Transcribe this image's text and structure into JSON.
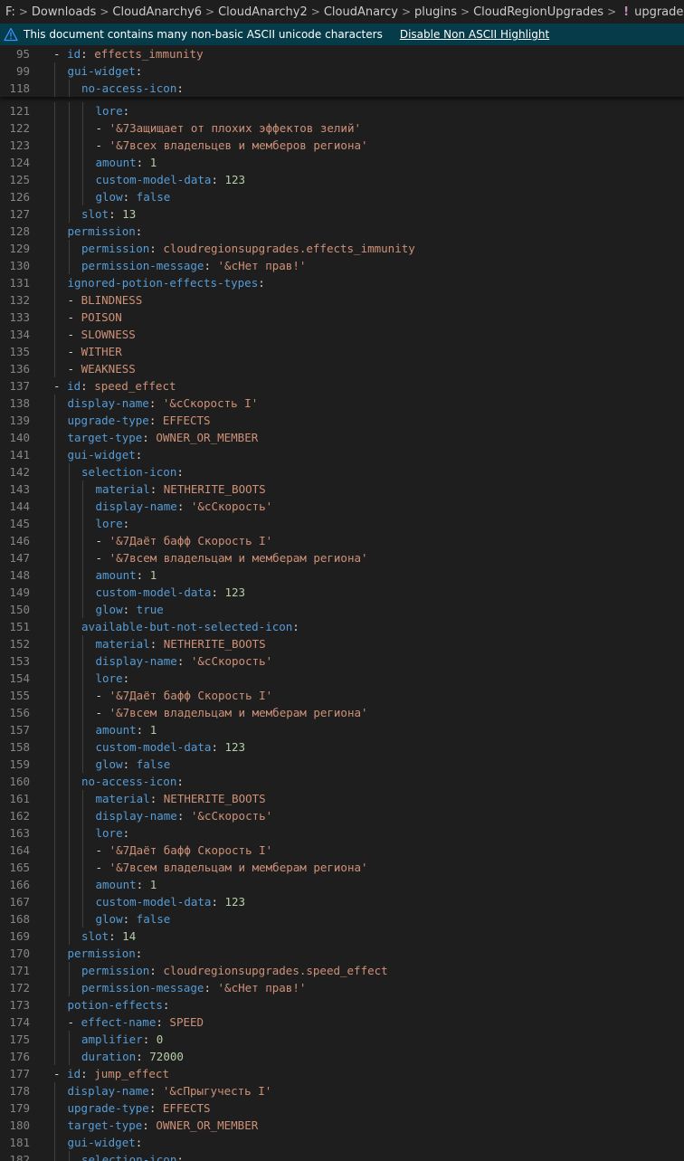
{
  "breadcrumb": {
    "items": [
      "F:",
      "Downloads",
      "CloudAnarchy6",
      "CloudAnarchy2",
      "CloudAnarcy",
      "plugins",
      "CloudRegionUpgrades"
    ],
    "file_icon": "!",
    "file": "upgrades.yml"
  },
  "banner": {
    "message": "This document contains many non-basic ASCII unicode characters",
    "action": "Disable Non ASCII Highlight"
  },
  "sticky_lines": [
    {
      "n": "95",
      "d": 0,
      "t": [
        [
          "p",
          "- "
        ],
        [
          "k",
          "id"
        ],
        [
          "p",
          ": "
        ],
        [
          "s",
          "effects_immunity"
        ]
      ]
    },
    {
      "n": "99",
      "d": 1,
      "t": [
        [
          "k",
          "gui-widget"
        ],
        [
          "p",
          ":"
        ]
      ]
    },
    {
      "n": "118",
      "d": 2,
      "t": [
        [
          "k",
          "no-access-icon"
        ],
        [
          "p",
          ":"
        ]
      ]
    }
  ],
  "lines": [
    {
      "n": "121",
      "d": 3,
      "t": [
        [
          "k",
          "lore"
        ],
        [
          "p",
          ":"
        ]
      ]
    },
    {
      "n": "122",
      "d": 3,
      "t": [
        [
          "p",
          "- "
        ],
        [
          "s",
          "'&7Защищает от плохих эффектов зелий'"
        ]
      ]
    },
    {
      "n": "123",
      "d": 3,
      "t": [
        [
          "p",
          "- "
        ],
        [
          "s",
          "'&7всех владельцев и мемберов региона'"
        ]
      ]
    },
    {
      "n": "124",
      "d": 3,
      "t": [
        [
          "k",
          "amount"
        ],
        [
          "p",
          ": "
        ],
        [
          "n",
          "1"
        ]
      ]
    },
    {
      "n": "125",
      "d": 3,
      "t": [
        [
          "k",
          "custom-model-data"
        ],
        [
          "p",
          ": "
        ],
        [
          "n",
          "123"
        ]
      ]
    },
    {
      "n": "126",
      "d": 3,
      "t": [
        [
          "k",
          "glow"
        ],
        [
          "p",
          ": "
        ],
        [
          "b",
          "false"
        ]
      ]
    },
    {
      "n": "127",
      "d": 2,
      "t": [
        [
          "k",
          "slot"
        ],
        [
          "p",
          ": "
        ],
        [
          "n",
          "13"
        ]
      ]
    },
    {
      "n": "128",
      "d": 1,
      "t": [
        [
          "k",
          "permission"
        ],
        [
          "p",
          ":"
        ]
      ]
    },
    {
      "n": "129",
      "d": 2,
      "t": [
        [
          "k",
          "permission"
        ],
        [
          "p",
          ": "
        ],
        [
          "s",
          "cloudregionsupgrades.effects_immunity"
        ]
      ]
    },
    {
      "n": "130",
      "d": 2,
      "t": [
        [
          "k",
          "permission-message"
        ],
        [
          "p",
          ": "
        ],
        [
          "s",
          "'&сНет прав!'"
        ]
      ]
    },
    {
      "n": "131",
      "d": 1,
      "t": [
        [
          "k",
          "ignored-potion-effects-types"
        ],
        [
          "p",
          ":"
        ]
      ]
    },
    {
      "n": "132",
      "d": 1,
      "t": [
        [
          "p",
          "- "
        ],
        [
          "s",
          "BLINDNESS"
        ]
      ]
    },
    {
      "n": "133",
      "d": 1,
      "t": [
        [
          "p",
          "- "
        ],
        [
          "s",
          "POISON"
        ]
      ]
    },
    {
      "n": "134",
      "d": 1,
      "t": [
        [
          "p",
          "- "
        ],
        [
          "s",
          "SLOWNESS"
        ]
      ]
    },
    {
      "n": "135",
      "d": 1,
      "t": [
        [
          "p",
          "- "
        ],
        [
          "s",
          "WITHER"
        ]
      ]
    },
    {
      "n": "136",
      "d": 1,
      "t": [
        [
          "p",
          "- "
        ],
        [
          "s",
          "WEAKNESS"
        ]
      ]
    },
    {
      "n": "137",
      "d": 0,
      "t": [
        [
          "p",
          "- "
        ],
        [
          "k",
          "id"
        ],
        [
          "p",
          ": "
        ],
        [
          "s",
          "speed_effect"
        ]
      ]
    },
    {
      "n": "138",
      "d": 1,
      "t": [
        [
          "k",
          "display-name"
        ],
        [
          "p",
          ": "
        ],
        [
          "s",
          "'&cСкорость I'"
        ]
      ]
    },
    {
      "n": "139",
      "d": 1,
      "t": [
        [
          "k",
          "upgrade-type"
        ],
        [
          "p",
          ": "
        ],
        [
          "s",
          "EFFECTS"
        ]
      ]
    },
    {
      "n": "140",
      "d": 1,
      "t": [
        [
          "k",
          "target-type"
        ],
        [
          "p",
          ": "
        ],
        [
          "s",
          "OWNER_OR_MEMBER"
        ]
      ]
    },
    {
      "n": "141",
      "d": 1,
      "t": [
        [
          "k",
          "gui-widget"
        ],
        [
          "p",
          ":"
        ]
      ]
    },
    {
      "n": "142",
      "d": 2,
      "t": [
        [
          "k",
          "selection-icon"
        ],
        [
          "p",
          ":"
        ]
      ]
    },
    {
      "n": "143",
      "d": 3,
      "t": [
        [
          "k",
          "material"
        ],
        [
          "p",
          ": "
        ],
        [
          "s",
          "NETHERITE_BOOTS"
        ]
      ]
    },
    {
      "n": "144",
      "d": 3,
      "t": [
        [
          "k",
          "display-name"
        ],
        [
          "p",
          ": "
        ],
        [
          "s",
          "'&cСкорость'"
        ]
      ]
    },
    {
      "n": "145",
      "d": 3,
      "t": [
        [
          "k",
          "lore"
        ],
        [
          "p",
          ":"
        ]
      ]
    },
    {
      "n": "146",
      "d": 3,
      "t": [
        [
          "p",
          "- "
        ],
        [
          "s",
          "'&7Даёт бафф Скорость I'"
        ]
      ]
    },
    {
      "n": "147",
      "d": 3,
      "t": [
        [
          "p",
          "- "
        ],
        [
          "s",
          "'&7всем владельцам и мемберам региона'"
        ]
      ]
    },
    {
      "n": "148",
      "d": 3,
      "t": [
        [
          "k",
          "amount"
        ],
        [
          "p",
          ": "
        ],
        [
          "n",
          "1"
        ]
      ]
    },
    {
      "n": "149",
      "d": 3,
      "t": [
        [
          "k",
          "custom-model-data"
        ],
        [
          "p",
          ": "
        ],
        [
          "n",
          "123"
        ]
      ]
    },
    {
      "n": "150",
      "d": 3,
      "t": [
        [
          "k",
          "glow"
        ],
        [
          "p",
          ": "
        ],
        [
          "b",
          "true"
        ]
      ]
    },
    {
      "n": "151",
      "d": 2,
      "t": [
        [
          "k",
          "available-but-not-selected-icon"
        ],
        [
          "p",
          ":"
        ]
      ]
    },
    {
      "n": "152",
      "d": 3,
      "t": [
        [
          "k",
          "material"
        ],
        [
          "p",
          ": "
        ],
        [
          "s",
          "NETHERITE_BOOTS"
        ]
      ]
    },
    {
      "n": "153",
      "d": 3,
      "t": [
        [
          "k",
          "display-name"
        ],
        [
          "p",
          ": "
        ],
        [
          "s",
          "'&cСкорость'"
        ]
      ]
    },
    {
      "n": "154",
      "d": 3,
      "t": [
        [
          "k",
          "lore"
        ],
        [
          "p",
          ":"
        ]
      ]
    },
    {
      "n": "155",
      "d": 3,
      "t": [
        [
          "p",
          "- "
        ],
        [
          "s",
          "'&7Даёт бафф Скорость I'"
        ]
      ]
    },
    {
      "n": "156",
      "d": 3,
      "t": [
        [
          "p",
          "- "
        ],
        [
          "s",
          "'&7всем владельцам и мемберам региона'"
        ]
      ]
    },
    {
      "n": "157",
      "d": 3,
      "t": [
        [
          "k",
          "amount"
        ],
        [
          "p",
          ": "
        ],
        [
          "n",
          "1"
        ]
      ]
    },
    {
      "n": "158",
      "d": 3,
      "t": [
        [
          "k",
          "custom-model-data"
        ],
        [
          "p",
          ": "
        ],
        [
          "n",
          "123"
        ]
      ]
    },
    {
      "n": "159",
      "d": 3,
      "t": [
        [
          "k",
          "glow"
        ],
        [
          "p",
          ": "
        ],
        [
          "b",
          "false"
        ]
      ]
    },
    {
      "n": "160",
      "d": 2,
      "t": [
        [
          "k",
          "no-access-icon"
        ],
        [
          "p",
          ":"
        ]
      ]
    },
    {
      "n": "161",
      "d": 3,
      "t": [
        [
          "k",
          "material"
        ],
        [
          "p",
          ": "
        ],
        [
          "s",
          "NETHERITE_BOOTS"
        ]
      ]
    },
    {
      "n": "162",
      "d": 3,
      "t": [
        [
          "k",
          "display-name"
        ],
        [
          "p",
          ": "
        ],
        [
          "s",
          "'&cСкорость'"
        ]
      ]
    },
    {
      "n": "163",
      "d": 3,
      "t": [
        [
          "k",
          "lore"
        ],
        [
          "p",
          ":"
        ]
      ]
    },
    {
      "n": "164",
      "d": 3,
      "t": [
        [
          "p",
          "- "
        ],
        [
          "s",
          "'&7Даёт бафф Скорость I'"
        ]
      ]
    },
    {
      "n": "165",
      "d": 3,
      "t": [
        [
          "p",
          "- "
        ],
        [
          "s",
          "'&7всем владельцам и мемберам региона'"
        ]
      ]
    },
    {
      "n": "166",
      "d": 3,
      "t": [
        [
          "k",
          "amount"
        ],
        [
          "p",
          ": "
        ],
        [
          "n",
          "1"
        ]
      ]
    },
    {
      "n": "167",
      "d": 3,
      "t": [
        [
          "k",
          "custom-model-data"
        ],
        [
          "p",
          ": "
        ],
        [
          "n",
          "123"
        ]
      ]
    },
    {
      "n": "168",
      "d": 3,
      "t": [
        [
          "k",
          "glow"
        ],
        [
          "p",
          ": "
        ],
        [
          "b",
          "false"
        ]
      ]
    },
    {
      "n": "169",
      "d": 2,
      "t": [
        [
          "k",
          "slot"
        ],
        [
          "p",
          ": "
        ],
        [
          "n",
          "14"
        ]
      ]
    },
    {
      "n": "170",
      "d": 1,
      "t": [
        [
          "k",
          "permission"
        ],
        [
          "p",
          ":"
        ]
      ]
    },
    {
      "n": "171",
      "d": 2,
      "t": [
        [
          "k",
          "permission"
        ],
        [
          "p",
          ": "
        ],
        [
          "s",
          "cloudregionsupgrades.speed_effect"
        ]
      ]
    },
    {
      "n": "172",
      "d": 2,
      "t": [
        [
          "k",
          "permission-message"
        ],
        [
          "p",
          ": "
        ],
        [
          "s",
          "'&сНет прав!'"
        ]
      ]
    },
    {
      "n": "173",
      "d": 1,
      "t": [
        [
          "k",
          "potion-effects"
        ],
        [
          "p",
          ":"
        ]
      ]
    },
    {
      "n": "174",
      "d": 1,
      "t": [
        [
          "p",
          "- "
        ],
        [
          "k",
          "effect-name"
        ],
        [
          "p",
          ": "
        ],
        [
          "s",
          "SPEED"
        ]
      ]
    },
    {
      "n": "175",
      "d": 2,
      "t": [
        [
          "k",
          "amplifier"
        ],
        [
          "p",
          ": "
        ],
        [
          "n",
          "0"
        ]
      ]
    },
    {
      "n": "176",
      "d": 2,
      "t": [
        [
          "k",
          "duration"
        ],
        [
          "p",
          ": "
        ],
        [
          "n",
          "72000"
        ]
      ]
    },
    {
      "n": "177",
      "d": 0,
      "t": [
        [
          "p",
          "- "
        ],
        [
          "k",
          "id"
        ],
        [
          "p",
          ": "
        ],
        [
          "s",
          "jump_effect"
        ]
      ]
    },
    {
      "n": "178",
      "d": 1,
      "t": [
        [
          "k",
          "display-name"
        ],
        [
          "p",
          ": "
        ],
        [
          "s",
          "'&cПрыгучесть I'"
        ]
      ]
    },
    {
      "n": "179",
      "d": 1,
      "t": [
        [
          "k",
          "upgrade-type"
        ],
        [
          "p",
          ": "
        ],
        [
          "s",
          "EFFECTS"
        ]
      ]
    },
    {
      "n": "180",
      "d": 1,
      "t": [
        [
          "k",
          "target-type"
        ],
        [
          "p",
          ": "
        ],
        [
          "s",
          "OWNER_OR_MEMBER"
        ]
      ]
    },
    {
      "n": "181",
      "d": 1,
      "t": [
        [
          "k",
          "gui-widget"
        ],
        [
          "p",
          ":"
        ]
      ]
    },
    {
      "n": "182",
      "d": 2,
      "t": [
        [
          "k",
          "selection-icon"
        ],
        [
          "p",
          ":"
        ]
      ]
    }
  ]
}
